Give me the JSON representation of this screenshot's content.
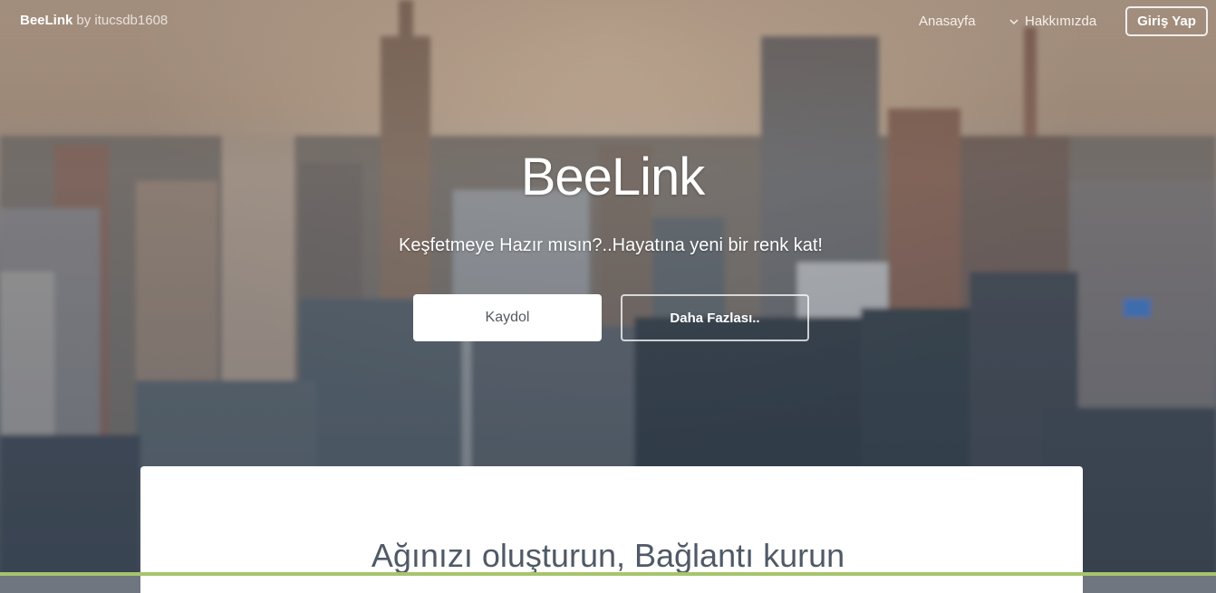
{
  "navbar": {
    "brand": "BeeLink",
    "brand_by": "by itucsdb1608",
    "home": "Anasayfa",
    "about": "Hakkımızda",
    "about_icon": "chevron-down-icon",
    "login": "Giriş Yap"
  },
  "hero": {
    "title": "BeeLink",
    "subtitle": "Keşfetmeye Hazır mısın?..Hayatına yeni bir renk kat!",
    "register_button": "Kaydol",
    "more_button": "Daha Fazlası.."
  },
  "content": {
    "heading": "Ağınızı oluşturun, Bağlantı kurun"
  },
  "colors": {
    "card_bg": "#ffffff",
    "heading_text": "#505a66",
    "register_text": "#555a60",
    "bottom_strip": "#a7c46c"
  }
}
